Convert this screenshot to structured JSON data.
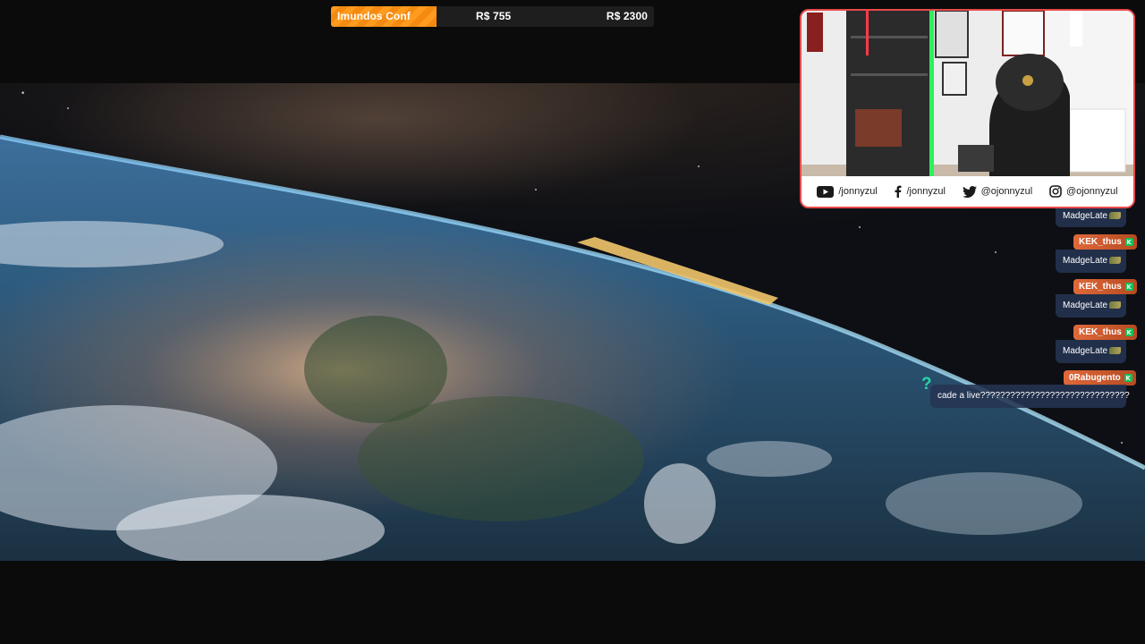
{
  "goal": {
    "name": "Imundos Conf",
    "current": "R$ 755",
    "target": "R$ 2300",
    "progress_fraction": 0.328,
    "fill_color": "#ff9b1f"
  },
  "webcam": {
    "border_color": "#e84a4a",
    "socials": [
      {
        "icon": "youtube-icon",
        "handle": "/jonnyzul"
      },
      {
        "icon": "facebook-icon",
        "handle": "/jonnyzul"
      },
      {
        "icon": "twitter-icon",
        "handle": "@ojonnyzul"
      },
      {
        "icon": "instagram-icon",
        "handle": "@ojonnyzul"
      }
    ]
  },
  "chat": {
    "messages": [
      {
        "user": "",
        "text": "MadgeLate"
      },
      {
        "user": "KEK_thus",
        "text": "MadgeLate"
      },
      {
        "user": "KEK_thus",
        "text": "MadgeLate"
      },
      {
        "user": "KEK_thus",
        "text": "MadgeLate"
      },
      {
        "user": "0Rabugento",
        "text": "cade a live??????????????????????????????"
      }
    ],
    "name_color": "#e0693a",
    "message_bg": "#263452",
    "badge_color": "#15c15a"
  }
}
